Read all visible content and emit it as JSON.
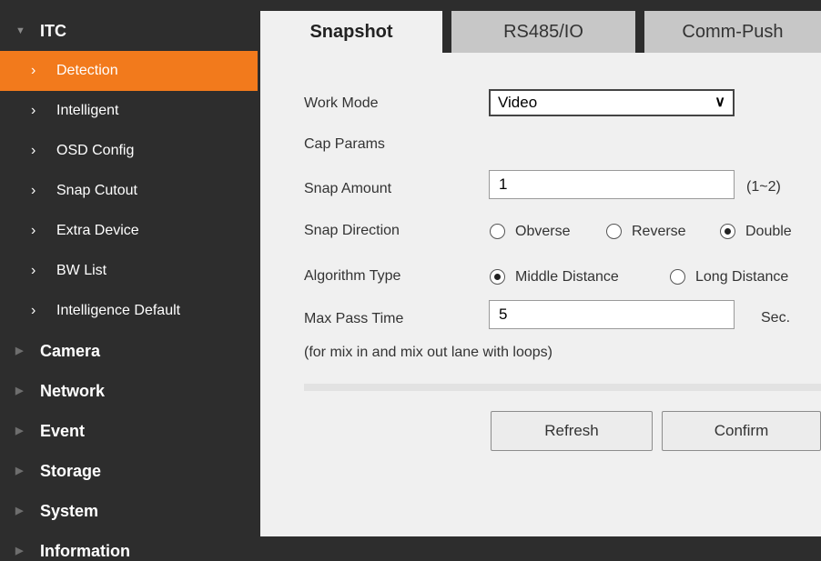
{
  "sidebar": {
    "header": {
      "label": "ITC",
      "icon": "triangle-down-icon"
    },
    "subitems": [
      {
        "label": "Detection",
        "active": true
      },
      {
        "label": "Intelligent",
        "active": false
      },
      {
        "label": "OSD Config",
        "active": false
      },
      {
        "label": "Snap Cutout",
        "active": false
      },
      {
        "label": "Extra Device",
        "active": false
      },
      {
        "label": "BW List",
        "active": false
      },
      {
        "label": "Intelligence Default",
        "active": false
      }
    ],
    "groups": [
      {
        "label": "Camera"
      },
      {
        "label": "Network"
      },
      {
        "label": "Event"
      },
      {
        "label": "Storage"
      },
      {
        "label": "System"
      },
      {
        "label": "Information"
      }
    ],
    "active_color": "#f27a1c"
  },
  "tabs": [
    {
      "label": "Snapshot",
      "active": true
    },
    {
      "label": "RS485/IO",
      "active": false
    },
    {
      "label": "Comm-Push",
      "active": false
    }
  ],
  "form": {
    "work_mode": {
      "label": "Work Mode",
      "value": "Video"
    },
    "cap_params": {
      "label": "Cap Params"
    },
    "snap_amount": {
      "label": "Snap Amount",
      "value": "1",
      "range": "(1~2)"
    },
    "snap_direction": {
      "label": "Snap Direction",
      "options": [
        "Obverse",
        "Reverse",
        "Double"
      ],
      "selected": "Double"
    },
    "algorithm_type": {
      "label": "Algorithm Type",
      "options": [
        "Middle Distance",
        "Long Distance"
      ],
      "selected": "Middle Distance"
    },
    "max_pass_time": {
      "label": "Max Pass Time",
      "value": "5",
      "unit": "Sec."
    },
    "note": "(for mix in and mix out lane with loops)"
  },
  "buttons": {
    "refresh": "Refresh",
    "confirm": "Confirm"
  }
}
